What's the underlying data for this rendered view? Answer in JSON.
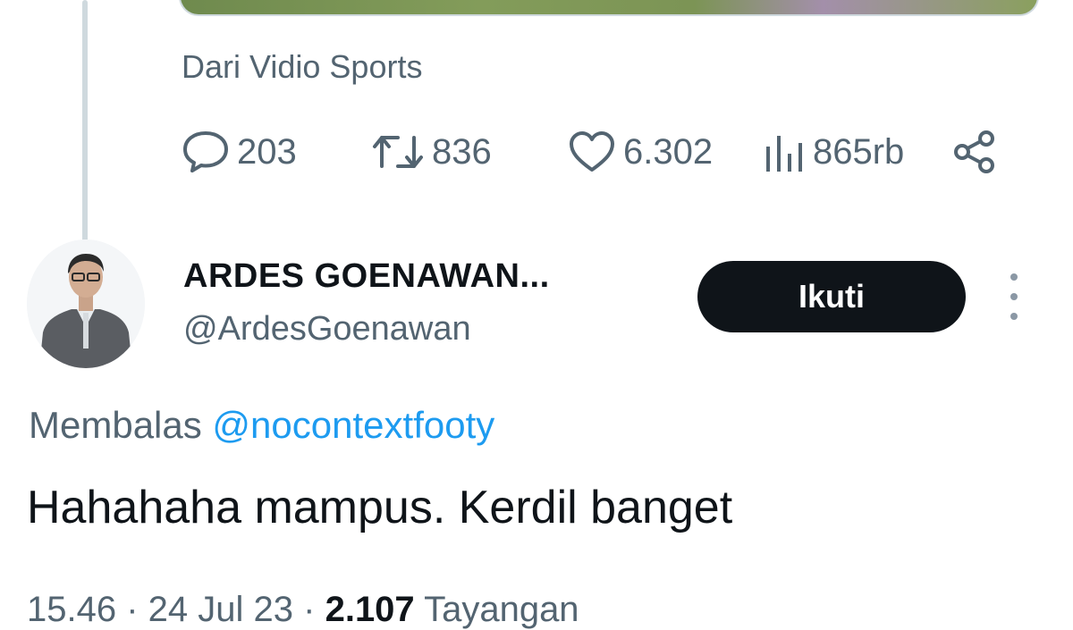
{
  "previous_tweet": {
    "source_label": "Dari Vidio Sports",
    "actions": {
      "replies": "203",
      "reposts": "836",
      "likes": "6.302",
      "views": "865rb"
    },
    "icons": [
      "reply-icon",
      "repost-icon",
      "like-icon",
      "views-icon",
      "share-icon"
    ]
  },
  "reply_tweet": {
    "author_name": "ARDES GOENAWAN...",
    "author_handle": "@ArdesGoenawan",
    "follow_label": "Ikuti",
    "replying_to_prefix": "Membalas",
    "replying_to_mention": "@nocontextfooty",
    "text": "Hahahaha mampus. Kerdil banget",
    "meta": {
      "time": "15.46",
      "date": "24 Jul 23",
      "views_count": "2.107",
      "views_label": "Tayangan"
    }
  },
  "colors": {
    "text_primary": "#0f1419",
    "text_secondary": "#536471",
    "accent_link": "#1d9bf0",
    "follow_button_bg": "#0f1419",
    "divider": "#cfd9de"
  }
}
